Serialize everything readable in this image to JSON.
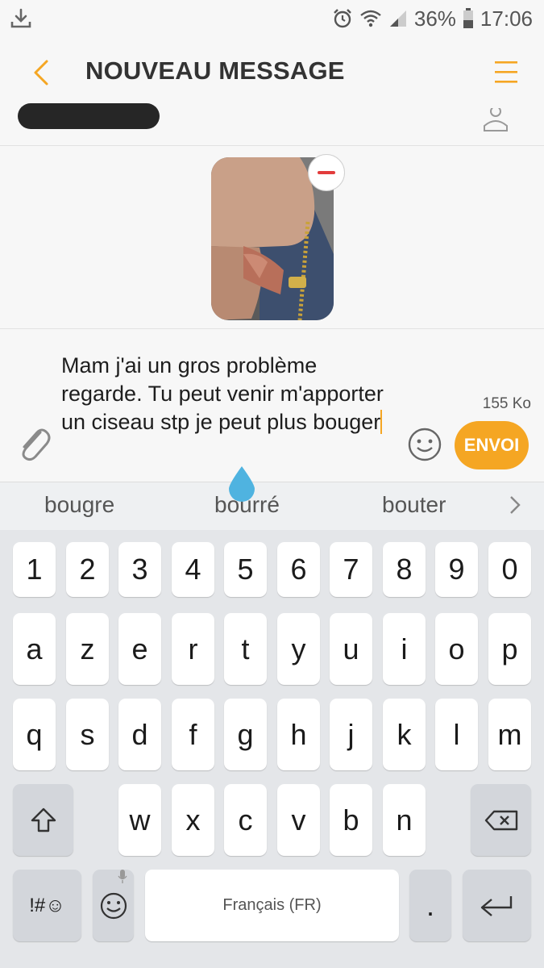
{
  "status_bar": {
    "battery_percent": "36%",
    "time": "17:06",
    "icons": [
      "download-icon",
      "alarm-icon",
      "wifi-icon",
      "signal-icon",
      "battery-icon"
    ]
  },
  "app_bar": {
    "title": "NOUVEAU MESSAGE",
    "back_icon": "back-chevron-icon",
    "menu_icon": "menu-icon"
  },
  "recipient": {
    "value_redacted": true,
    "contacts_icon": "contacts-icon"
  },
  "attachment": {
    "type": "photo",
    "remove_icon": "remove-icon"
  },
  "compose": {
    "message": "Mam j'ai un gros problème regarde. Tu peut venir m'apporter un ciseau stp je peut plus bouger",
    "size": "155 Ko",
    "send_label": "ENVOI"
  },
  "suggestions": [
    "bougre",
    "bourré",
    "bouter"
  ],
  "keyboard": {
    "row_numbers": [
      "1",
      "2",
      "3",
      "4",
      "5",
      "6",
      "7",
      "8",
      "9",
      "0"
    ],
    "row_1": [
      "a",
      "z",
      "e",
      "r",
      "t",
      "y",
      "u",
      "i",
      "o",
      "p"
    ],
    "row_2": [
      "q",
      "s",
      "d",
      "f",
      "g",
      "h",
      "j",
      "k",
      "l",
      "m"
    ],
    "row_3": [
      "w",
      "x",
      "c",
      "v",
      "b",
      "n"
    ],
    "symbols_label": "!#☺",
    "space_label": "Français (FR)",
    "period_label": "."
  },
  "colors": {
    "accent": "#f5a623",
    "remove": "#e23c3c",
    "cursor_handle": "#4fb3e0"
  }
}
